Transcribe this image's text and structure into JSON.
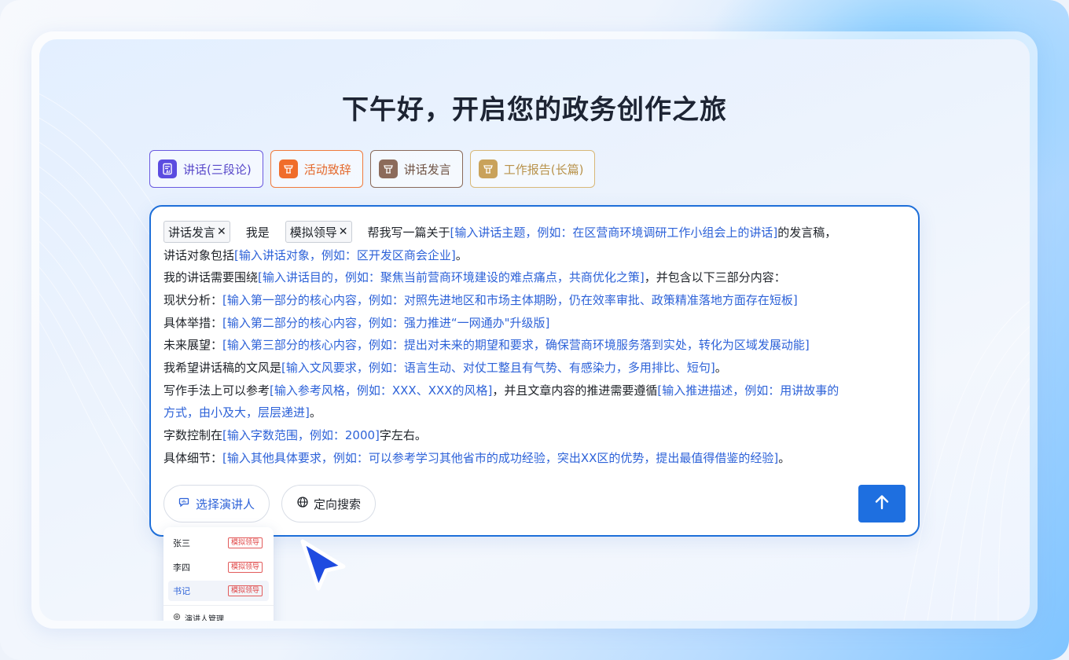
{
  "greeting": "下午好，开启您的政务创作之旅",
  "tabs": [
    {
      "label": "讲话(三段论)",
      "icon": "ai-document-icon"
    },
    {
      "label": "活动致辞",
      "icon": "podium-icon"
    },
    {
      "label": "讲话发言",
      "icon": "podium-icon"
    },
    {
      "label": "工作报告(长篇)",
      "icon": "podium-icon"
    }
  ],
  "editor": {
    "chip_type": "讲话发言",
    "chip_speaker": "模拟领导",
    "text_i_am": "我是",
    "line1_a": "帮我写一篇关于",
    "line1_ph": "[输入讲话主题，例如：在区营商环境调研工作小组会上的讲话]",
    "line1_b": "的发言稿，",
    "line2_a": "讲话对象包括",
    "line2_ph": "[输入讲话对象，例如：区开发区商会企业]",
    "line2_b": "。",
    "line3_a": "我的讲话需要围绕",
    "line3_ph": "[输入讲话目的，例如：聚焦当前营商环境建设的难点痛点，共商优化之策]",
    "line3_b": "，并包含以下三部分内容：",
    "line4_a": "现状分析：",
    "line4_ph": "[输入第一部分的核心内容，例如：对照先进地区和市场主体期盼，仍在效率审批、政策精准落地方面存在短板]",
    "line5_a": "具体举措：",
    "line5_ph": "[输入第二部分的核心内容，例如：强力推进“一网通办\"升级版]",
    "line6_a": "未来展望：",
    "line6_ph": "[输入第三部分的核心内容，例如：提出对未来的期望和要求，确保营商环境服务落到实处，转化为区域发展动能]",
    "line7_a": "我希望讲话稿的文风是",
    "line7_ph": "[输入文风要求，例如：语言生动、对仗工整且有气势、有感染力，多用排比、短句]",
    "line7_b": "。",
    "line8_a": "写作手法上可以参考",
    "line8_ph": "[输入参考风格，例如：XXX、XXX的风格]",
    "line8_b": "，并且文章内容的推进需要遵循",
    "line8_ph2": "[输入推进描述，例如：用讲故事的",
    "line9_ph": "方式，由小及大，层层递进]",
    "line9_b": "。",
    "line10_a": "字数控制在",
    "line10_ph": "[输入字数范围，例如：2000]",
    "line10_b": "字左右。",
    "line11_a": "具体细节：",
    "line11_ph": "[输入其他具体要求，例如：可以参考学习其他省市的成功经验，突出XX区的优势，提出最值得借鉴的经验]",
    "line11_b": "。"
  },
  "buttons": {
    "select_speaker": "选择演讲人",
    "directed_search": "定向搜索"
  },
  "dropdown": {
    "items": [
      {
        "name": "张三",
        "tag": "模拟领导"
      },
      {
        "name": "李四",
        "tag": "模拟领导"
      },
      {
        "name": "书记",
        "tag": "模拟领导"
      }
    ],
    "manage": "演讲人管理"
  },
  "colors": {
    "accent": "#1e6fe0",
    "placeholder": "#2d62d8",
    "tag_red": "#e04848"
  }
}
